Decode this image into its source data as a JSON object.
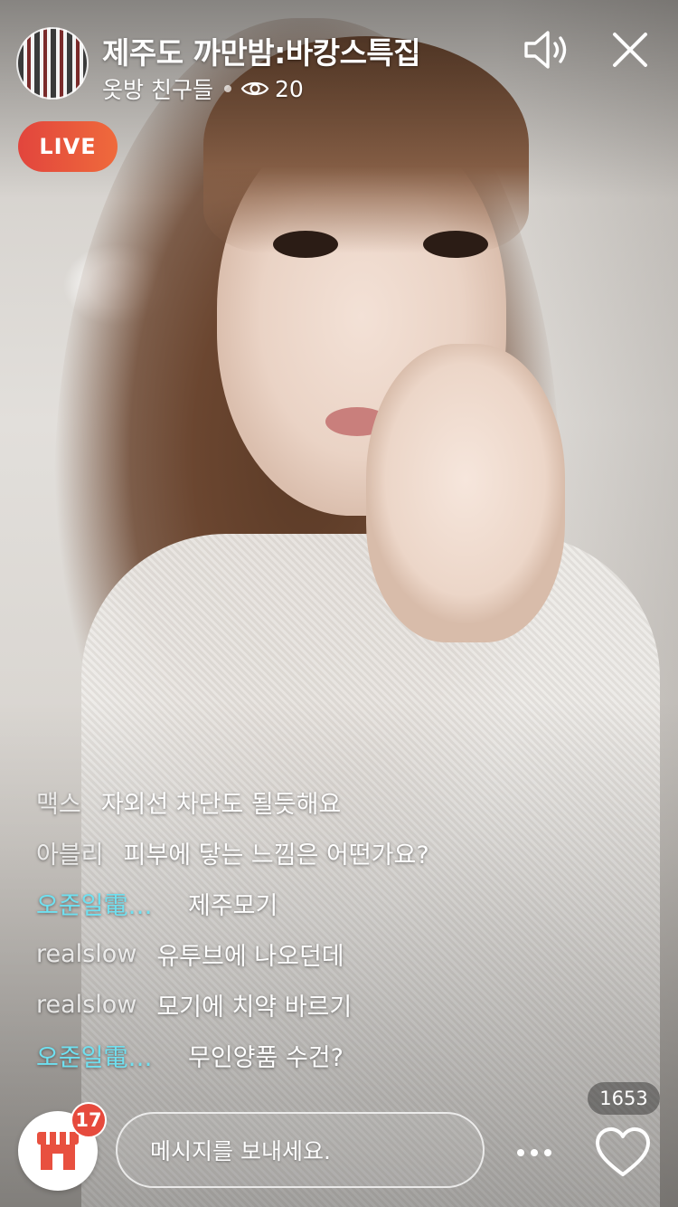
{
  "header": {
    "title": "제주도 까만밤:바캉스특집",
    "channel": "옷방 친구들",
    "viewer_count": "20"
  },
  "live_badge": "LIVE",
  "chat": [
    {
      "user": "맥스",
      "message": "자외선 차단도 될듯해요",
      "accent": false
    },
    {
      "user": "아블리",
      "message": "피부에 닿는 느낌은 어떤가요?",
      "accent": false
    },
    {
      "user": "오준일電…",
      "message": "제주모기",
      "accent": true
    },
    {
      "user": "realslow",
      "message": "유투브에 나오던데",
      "accent": false
    },
    {
      "user": "realslow",
      "message": "모기에 치약 바르기",
      "accent": false
    },
    {
      "user": "오준일電…",
      "message": "무인양품 수건?",
      "accent": true
    }
  ],
  "bottom": {
    "store_badge": "17",
    "message_placeholder": "메시지를 보내세요.",
    "like_count": "1653"
  },
  "icons": {
    "sound": "speaker-icon",
    "close": "close-icon",
    "viewers": "eye-icon",
    "store": "store-icon",
    "more": "more-dots-icon",
    "like": "heart-icon"
  },
  "colors": {
    "live_gradient_start": "#e2453d",
    "live_gradient_end": "#ef6a3c",
    "accent_username": "#6fe0f0",
    "badge_red": "#e64a3d",
    "store_icon": "#e8503f"
  }
}
